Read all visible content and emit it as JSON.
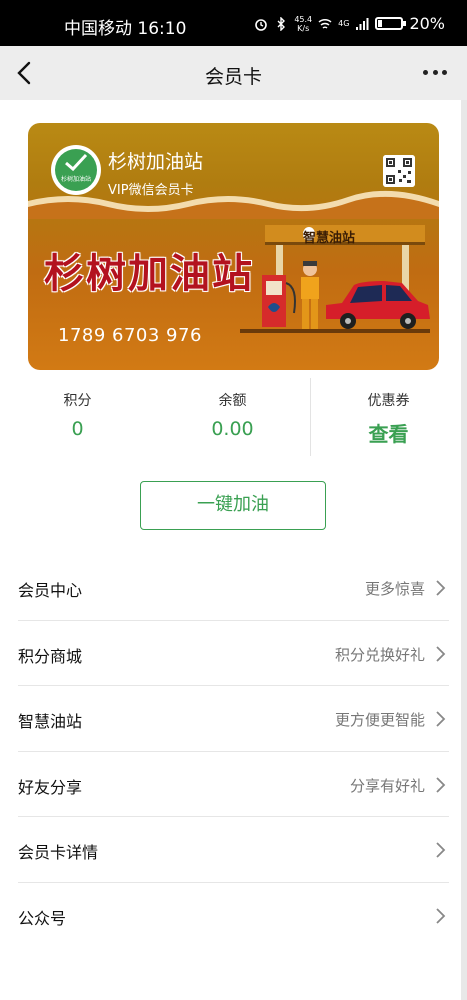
{
  "status_bar": {
    "carrier_time": "中国移动 16:10",
    "net_speed_value": "45.4",
    "net_speed_unit": "K/s",
    "signal_tag": "4G",
    "battery": "20%",
    "battery_level": 0.2
  },
  "nav": {
    "title": "会员卡"
  },
  "card": {
    "station_name": "杉树加油站",
    "card_type": "VIP微信会员卡",
    "logo_text": "杉树加油站",
    "banner_text": "杉树加油站",
    "sign_text": "智慧油站",
    "card_number": "1789 6703 976"
  },
  "stats": [
    {
      "label": "积分",
      "value": "0"
    },
    {
      "label": "余额",
      "value": "0.00"
    },
    {
      "label": "优惠券",
      "value": "查看"
    }
  ],
  "refuel_button": "一键加油",
  "menu": [
    {
      "label": "会员中心",
      "hint": "更多惊喜"
    },
    {
      "label": "积分商城",
      "hint": "积分兑换好礼"
    },
    {
      "label": "智慧油站",
      "hint": "更方便更智能"
    },
    {
      "label": "好友分享",
      "hint": "分享有好礼"
    },
    {
      "label": "会员卡详情",
      "hint": ""
    },
    {
      "label": "公众号",
      "hint": ""
    }
  ],
  "colors": {
    "accent": "#3aa052",
    "card_gold": "#b98a14",
    "banner_red": "#b3121f"
  }
}
